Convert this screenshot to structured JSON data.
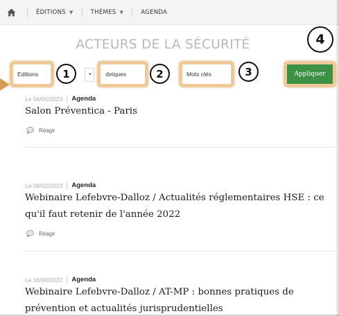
{
  "nav": {
    "home_icon": "home-icon",
    "items": [
      {
        "label": "ÉDITIONS",
        "dropdown": true
      },
      {
        "label": "THÈMES",
        "dropdown": true
      },
      {
        "label": "AGENDA",
        "dropdown": false
      }
    ]
  },
  "page": {
    "title": "ACTEURS DE LA SÉCURITÉ"
  },
  "filters": {
    "editions_label": "Editions",
    "rubriques_label": "Rubriques",
    "rubriques_visible": "ıbriques",
    "keywords_label": "Mots clés",
    "apply_label": "Appliquer",
    "annotations": [
      "1",
      "2",
      "3",
      "4"
    ]
  },
  "articles": [
    {
      "date": "Le 04/05/2023",
      "category": "Agenda",
      "title": "Salon Préventica - Paris",
      "react": "Réagir"
    },
    {
      "date": "Le 08/02/2023",
      "category": "Agenda",
      "title": "Webinaire Lefebvre-Dalloz / Actualités réglementaires HSE : ce qu'il faut retenir de l'année 2022",
      "react": "Réagir"
    },
    {
      "date": "Le 16/06/2022",
      "category": "Agenda",
      "title": "Webinaire Lefebvre-Dalloz / AT-MP : bonnes pratiques de prévention et actualités jurisprudentielles",
      "react": ""
    }
  ],
  "colors": {
    "highlight": "#f0c99a",
    "apply_button": "#3d9146",
    "arrow": "#d79b56",
    "title": "#b8b8b8"
  }
}
